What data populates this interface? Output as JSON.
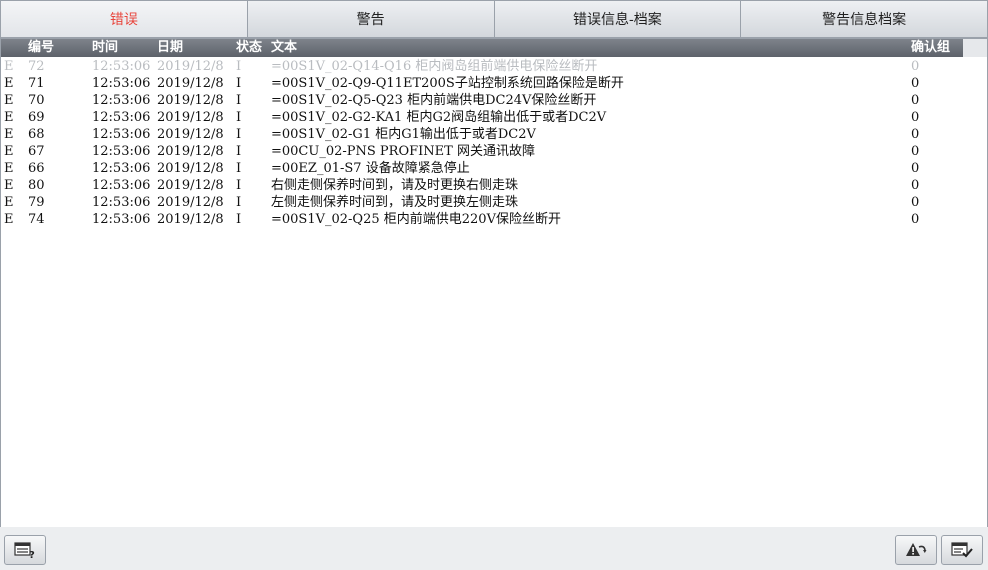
{
  "tabs": [
    {
      "label": "错误",
      "active": true
    },
    {
      "label": "警告",
      "active": false
    },
    {
      "label": "错误信息-档案",
      "active": false
    },
    {
      "label": "警告信息档案",
      "active": false
    }
  ],
  "table": {
    "headers": {
      "number": "编号",
      "time": "时间",
      "date": "日期",
      "state": "状态",
      "text": "文本",
      "ack_group": "确认组"
    },
    "rows": [
      {
        "type": "E",
        "number": "72",
        "time": "12:53:06",
        "date": "2019/12/8",
        "state": "I",
        "text": "=00S1V_02-Q14-Q16 柜内阀岛组前端供电保险丝断开",
        "ack": "0"
      },
      {
        "type": "E",
        "number": "71",
        "time": "12:53:06",
        "date": "2019/12/8",
        "state": "I",
        "text": "=00S1V_02-Q9-Q11ET200S子站控制系统回路保险是断开",
        "ack": "0"
      },
      {
        "type": "E",
        "number": "70",
        "time": "12:53:06",
        "date": "2019/12/8",
        "state": "I",
        "text": "=00S1V_02-Q5-Q23 柜内前端供电DC24V保险丝断开",
        "ack": "0"
      },
      {
        "type": "E",
        "number": "69",
        "time": "12:53:06",
        "date": "2019/12/8",
        "state": "I",
        "text": "=00S1V_02-G2-KA1 柜内G2阀岛组输出低于或者DC2V",
        "ack": "0"
      },
      {
        "type": "E",
        "number": "68",
        "time": "12:53:06",
        "date": "2019/12/8",
        "state": "I",
        "text": "=00S1V_02-G1 柜内G1输出低于或者DC2V",
        "ack": "0"
      },
      {
        "type": "E",
        "number": "67",
        "time": "12:53:06",
        "date": "2019/12/8",
        "state": "I",
        "text": "=00CU_02-PNS PROFINET 网关通讯故障",
        "ack": "0"
      },
      {
        "type": "E",
        "number": "66",
        "time": "12:53:06",
        "date": "2019/12/8",
        "state": "I",
        "text": "=00EZ_01-S7 设备故障紧急停止",
        "ack": "0"
      },
      {
        "type": "E",
        "number": "80",
        "time": "12:53:06",
        "date": "2019/12/8",
        "state": "I",
        "text": "右侧走侧保养时间到，请及时更换右侧走珠",
        "ack": "0"
      },
      {
        "type": "E",
        "number": "79",
        "time": "12:53:06",
        "date": "2019/12/8",
        "state": "I",
        "text": "左侧走侧保养时间到，请及时更换左侧走珠",
        "ack": "0"
      },
      {
        "type": "E",
        "number": "74",
        "time": "12:53:06",
        "date": "2019/12/8",
        "state": "I",
        "text": "=00S1V_02-Q25 柜内前端供电220V保险丝断开",
        "ack": "0"
      }
    ]
  },
  "buttons": {
    "left_icon": "message-list-help-icon",
    "acknowledge_icon": "alarm-acknowledge-icon",
    "confirm_icon": "message-list-confirm-icon"
  },
  "colors": {
    "active_tab_text": "#e8453c",
    "header_bg": "#6b7078",
    "faded_row_text": "#b9bcc0"
  }
}
